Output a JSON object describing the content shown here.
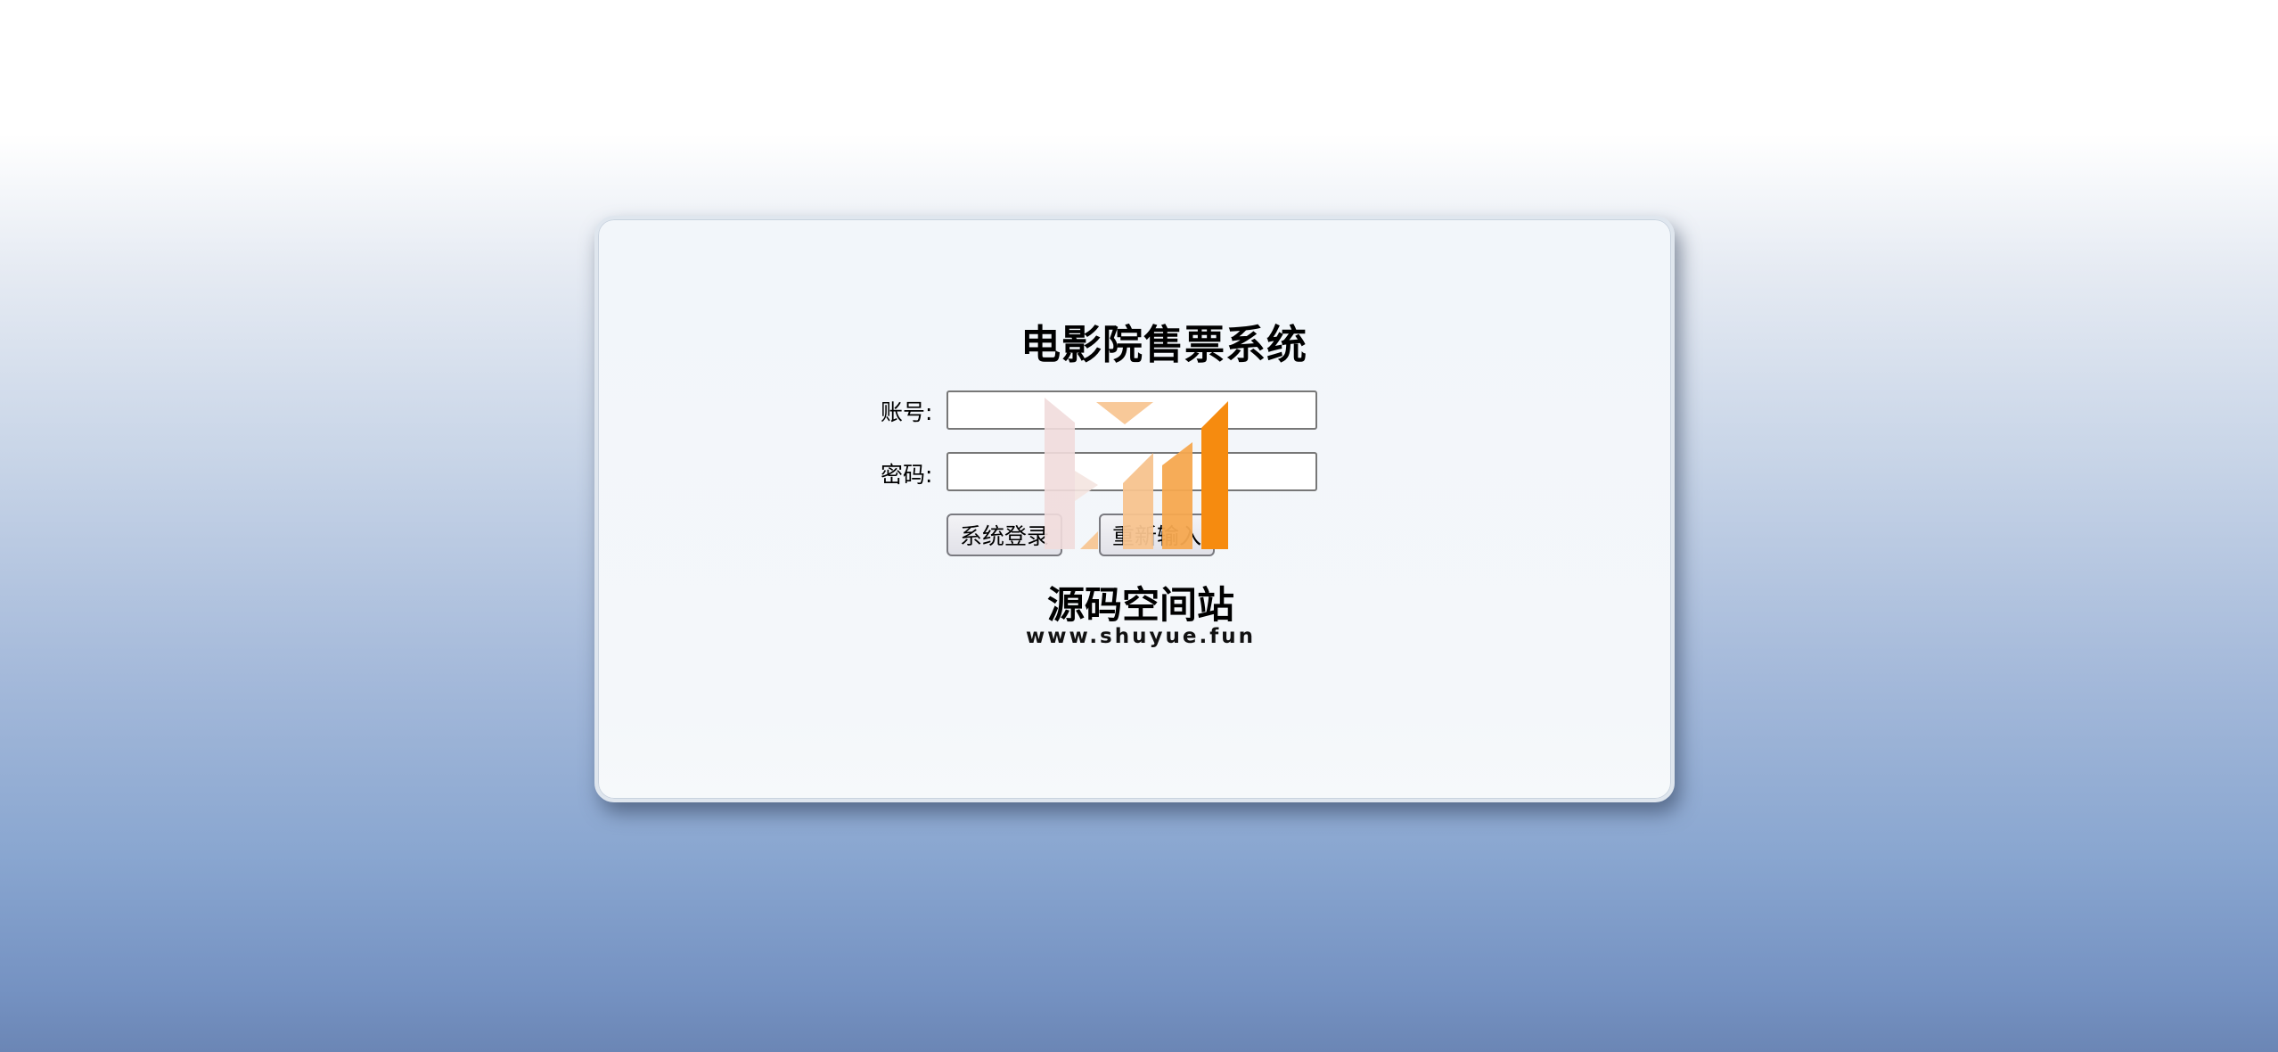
{
  "login": {
    "title": "电影院售票系统",
    "account_label": "账号:",
    "account_value": "",
    "password_label": "密码:",
    "password_value": "",
    "login_button": "系统登录",
    "reset_button": "重新输入"
  },
  "watermark": {
    "name": "源码空间站",
    "url": "www.shuyue.fun",
    "colors": {
      "orange": "#f68b0f",
      "light_orange": "#f7c38e",
      "pink": "#f1dcdc"
    }
  }
}
